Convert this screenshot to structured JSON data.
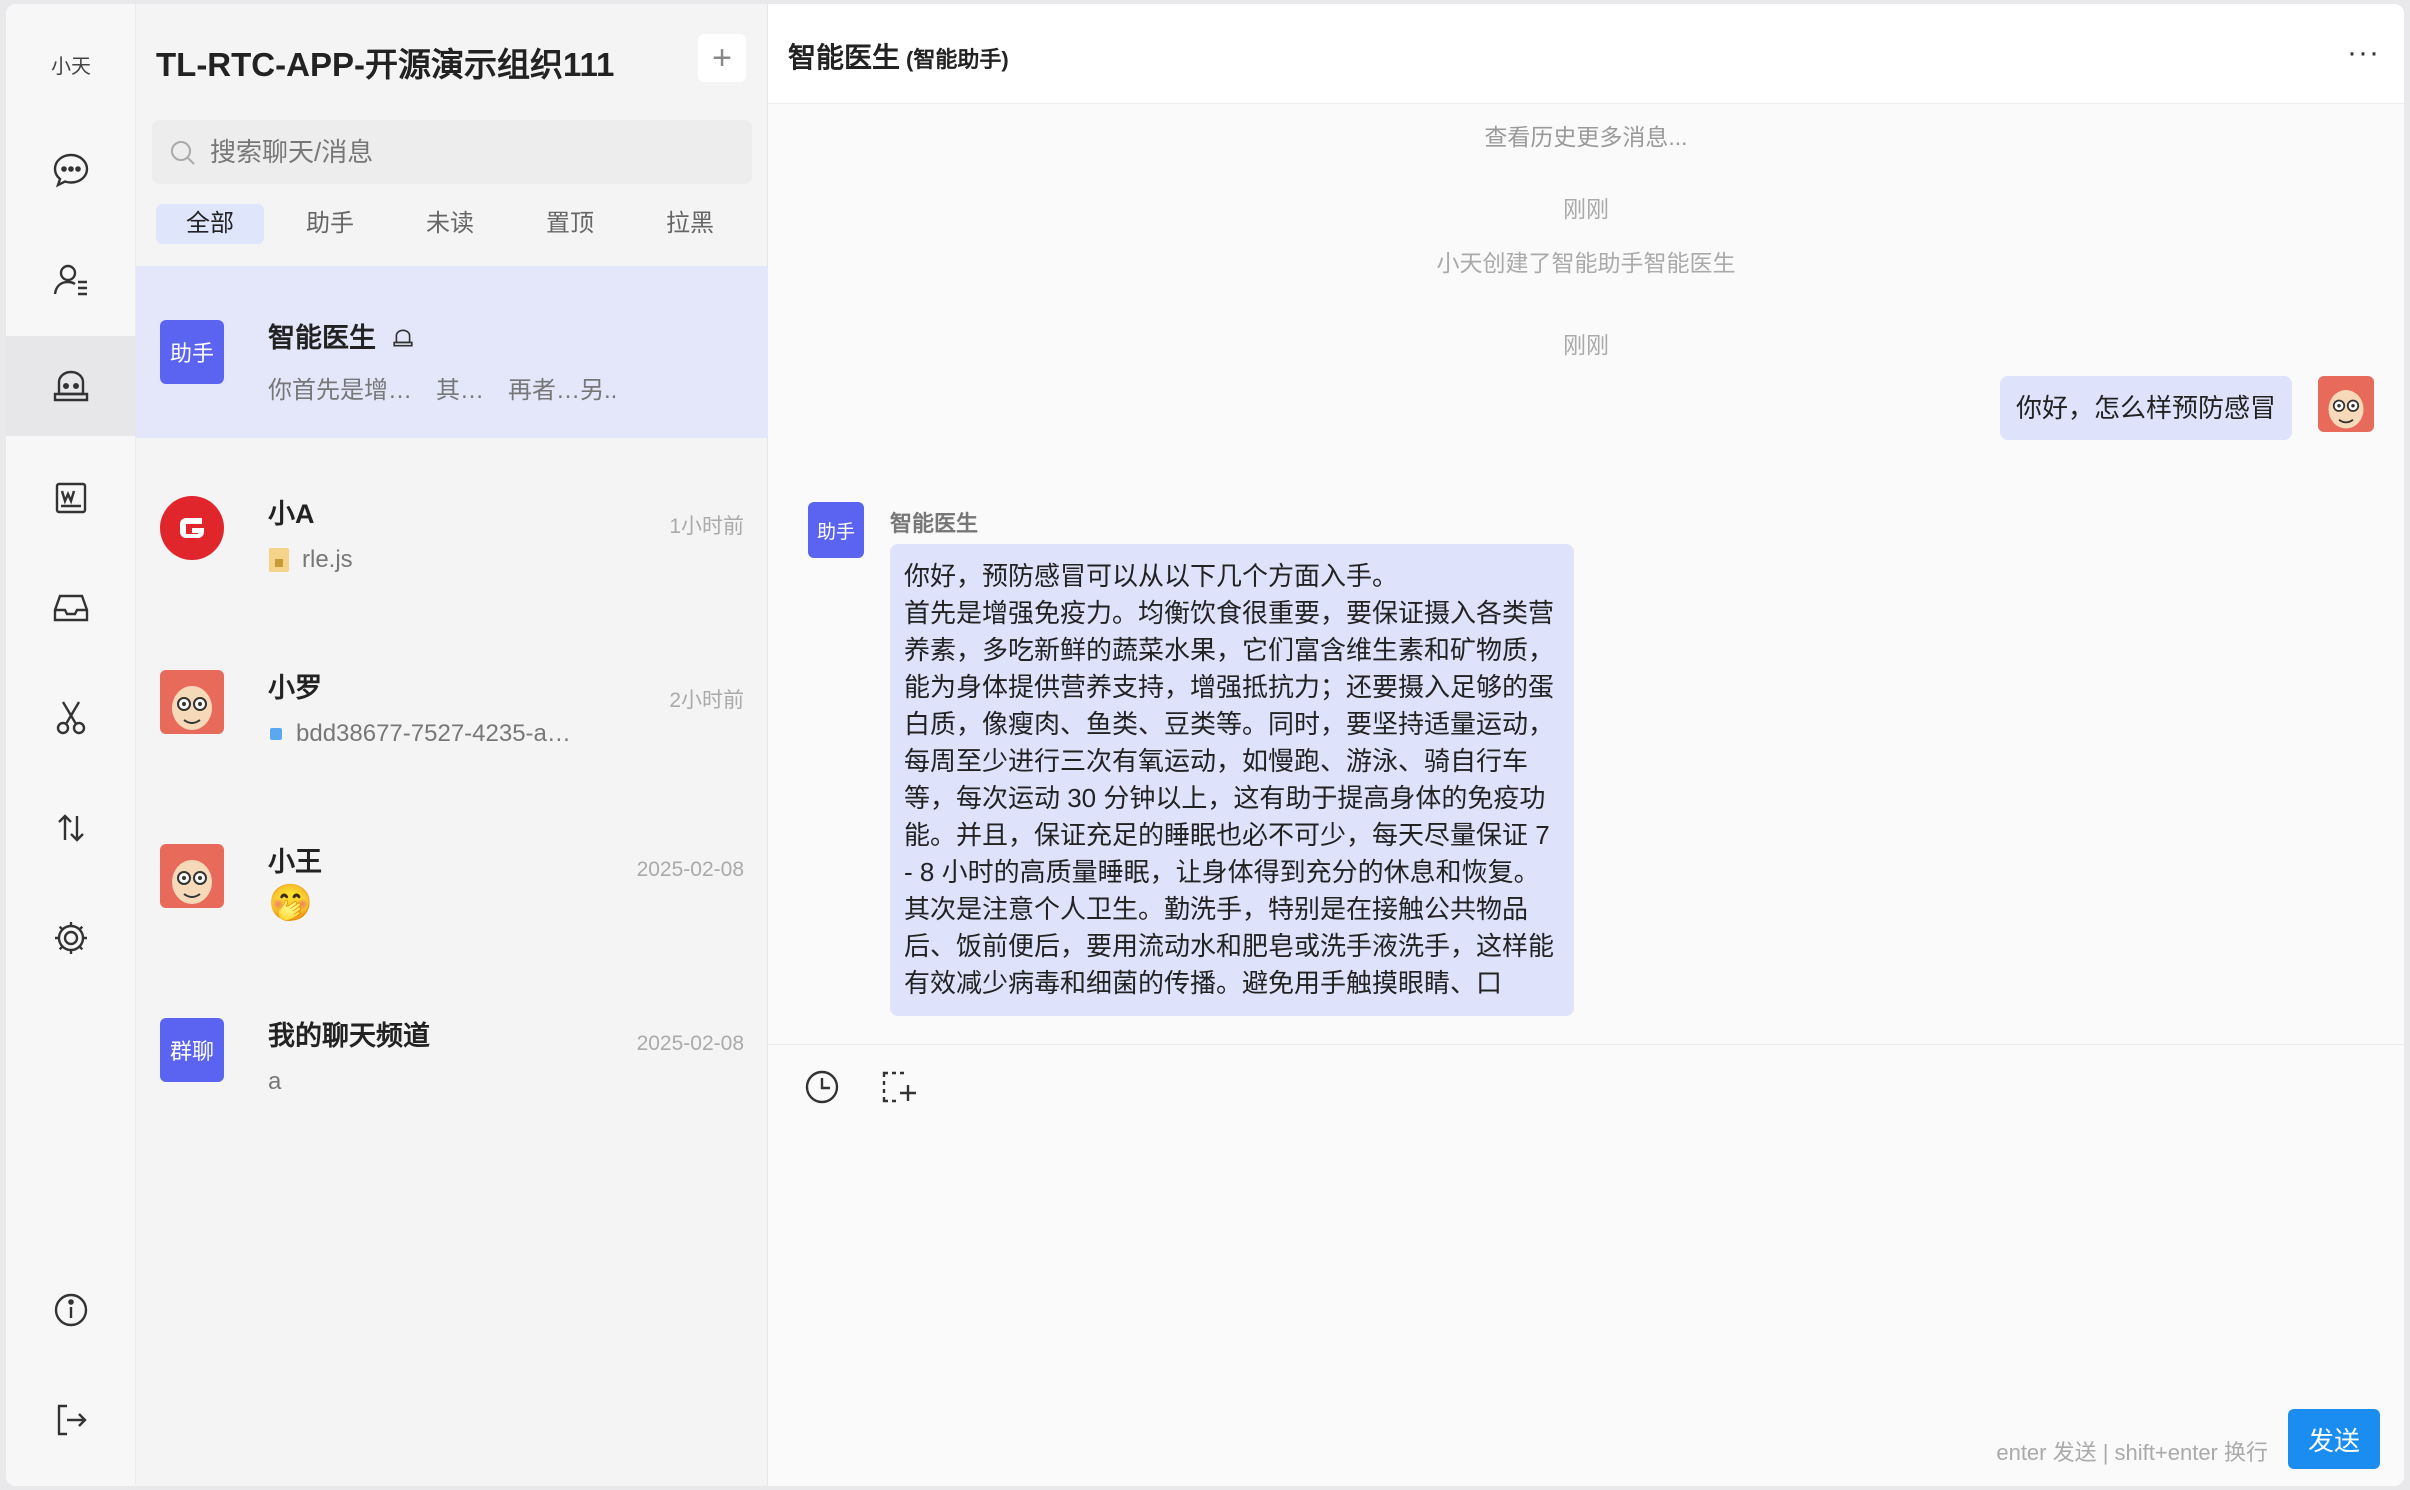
{
  "user": {
    "short_name": "小天"
  },
  "rail": {
    "items": [
      {
        "icon": "chat-bubble-icon"
      },
      {
        "icon": "contacts-icon"
      },
      {
        "icon": "robot-icon",
        "active": true
      },
      {
        "icon": "word-doc-icon"
      },
      {
        "icon": "inbox-icon"
      },
      {
        "icon": "scissors-icon"
      },
      {
        "icon": "transfer-icon"
      },
      {
        "icon": "gear-icon"
      },
      {
        "icon": "info-icon"
      },
      {
        "icon": "logout-icon"
      }
    ]
  },
  "list": {
    "org_title": "TL-RTC-APP-开源演示组织111",
    "add_label": "+",
    "search_placeholder": "搜索聊天/消息",
    "tabs": [
      "全部",
      "助手",
      "未读",
      "置顶",
      "拉黑"
    ],
    "active_tab": "全部",
    "conversations": [
      {
        "name": "智能医生",
        "avatar_text": "助手",
        "preview": "你首先是增…　其…　再者…另..",
        "time": "",
        "active": true,
        "bot": true
      },
      {
        "name": "小A",
        "avatar_type": "g-logo",
        "preview": "rle.js",
        "time": "1小时前"
      },
      {
        "name": "小罗",
        "avatar_type": "cartoon",
        "preview": "bdd38677-7527-4235-a…",
        "time": "2小时前"
      },
      {
        "name": "小王",
        "avatar_type": "cartoon",
        "preview": "🤭",
        "time": "2025-02-08"
      },
      {
        "name": "我的聊天频道",
        "avatar_text": "群聊",
        "preview": "a",
        "time": "2025-02-08"
      }
    ]
  },
  "chat": {
    "title": "智能医生",
    "subtitle": "(智能助手)",
    "more_label": "···",
    "history_link": "查看历史更多消息...",
    "time_1": "刚刚",
    "system_note": "小天创建了智能助手智能医生",
    "time_2": "刚刚",
    "my_message": "你好，怎么样预防感冒",
    "bot_name": "智能医生",
    "bot_avatar_text": "助手",
    "bot_message": [
      "你好，预防感冒可以从以下几个方面入手。",
      "首先是增强免疫力。均衡饮食很重要，要保证摄入各类营养素，多吃新鲜的蔬菜水果，它们富含维生素和矿物质，能为身体提供营养支持，增强抵抗力；还要摄入足够的蛋白质，像瘦肉、鱼类、豆类等。同时，要坚持适量运动，每周至少进行三次有氧运动，如慢跑、游泳、骑自行车等，每次运动 30 分钟以上，这有助于提高身体的免疫功能。并且，保证充足的睡眠也必不可少，每天尽量保证 7 - 8 小时的高质量睡眠，让身体得到充分的休息和恢复。",
      "其次是注意个人卫生。勤洗手，特别是在接触公共物品后、饭前便后，要用流动水和肥皂或洗手液洗手，这样能有效减少病毒和细菌的传播。避免用手触摸眼睛、口"
    ],
    "composer": {
      "hint": "enter 发送 | shift+enter 换行",
      "send_label": "发送"
    }
  },
  "colors": {
    "accent": "#5b64f1",
    "send": "#1b8cf0",
    "bubble": "#dfe2fb"
  }
}
